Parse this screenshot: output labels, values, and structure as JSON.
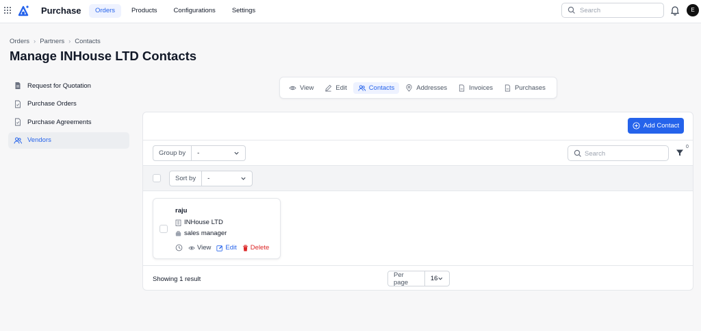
{
  "header": {
    "app_title": "Purchase",
    "nav": [
      "Orders",
      "Products",
      "Configurations",
      "Settings"
    ],
    "search_placeholder": "Search",
    "avatar_initial": "E"
  },
  "breadcrumb": [
    "Orders",
    "Partners",
    "Contacts"
  ],
  "page_title": "Manage INHouse LTD Contacts",
  "sidebar": {
    "items": [
      {
        "label": "Request for Quotation",
        "icon": "document-icon"
      },
      {
        "label": "Purchase Orders",
        "icon": "document-check-icon"
      },
      {
        "label": "Purchase Agreements",
        "icon": "document-check-icon"
      },
      {
        "label": "Vendors",
        "icon": "users-icon",
        "active": true
      }
    ]
  },
  "subtabs": [
    {
      "label": "View",
      "icon": "eye-icon"
    },
    {
      "label": "Edit",
      "icon": "pencil-icon"
    },
    {
      "label": "Contacts",
      "icon": "users-icon",
      "active": true
    },
    {
      "label": "Addresses",
      "icon": "map-pin-icon"
    },
    {
      "label": "Invoices",
      "icon": "document-icon"
    },
    {
      "label": "Purchases",
      "icon": "document-icon"
    }
  ],
  "toolbar": {
    "add_contact": "Add Contact",
    "group_by_label": "Group by",
    "group_by_value": "-",
    "search_placeholder": "Search",
    "filter_count": "0",
    "sort_by_label": "Sort by",
    "sort_by_value": "-"
  },
  "contacts": [
    {
      "name": "raju",
      "company": "INHouse LTD",
      "job_title": "sales manager",
      "actions": {
        "view": "View",
        "edit": "Edit",
        "delete": "Delete"
      }
    }
  ],
  "footer": {
    "showing": "Showing 1 result",
    "per_page_label": "Per page",
    "per_page_value": "16"
  },
  "colors": {
    "accent": "#2563eb",
    "danger": "#dc2626",
    "active_bg": "#eef2ff"
  }
}
